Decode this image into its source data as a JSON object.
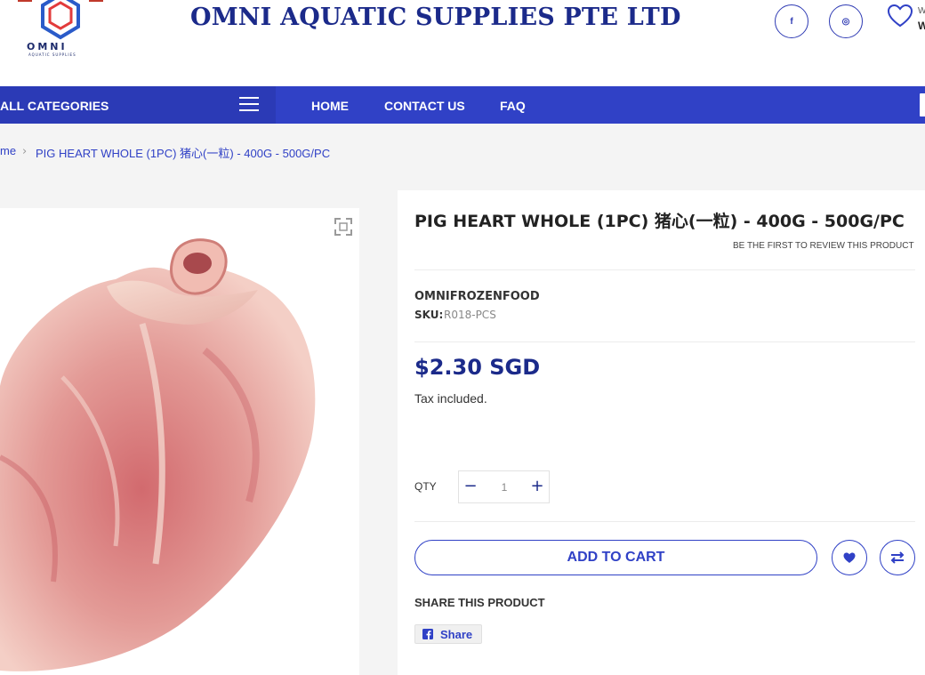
{
  "header": {
    "logo_text": "OMNI",
    "logo_sub": "AQUATIC SUPPLIES",
    "brand_name": "OMNI AQUATIC SUPPLIES PTE LTD",
    "social": [
      {
        "icon": "facebook-icon",
        "glyph": "f"
      },
      {
        "icon": "instagram-icon",
        "glyph": "◎"
      }
    ],
    "wishlist_small": "W",
    "wishlist_big": "W"
  },
  "nav": {
    "all_categories": "ALL CATEGORIES",
    "links": [
      "HOME",
      "CONTACT US",
      "FAQ"
    ]
  },
  "breadcrumb": {
    "home": "me",
    "separator": "›",
    "current": "PIG HEART WHOLE (1PC) 猪心(一粒) - 400G - 500G/PC"
  },
  "product": {
    "title": "PIG HEART WHOLE (1PC) 猪心(一粒) - 400G - 500G/PC",
    "review_link": "BE THE FIRST TO REVIEW THIS PRODUCT",
    "vendor": "OMNIFROZENFOOD",
    "sku_label": "SKU:",
    "sku_value": "R018-PCS",
    "price": "$2.30 SGD",
    "tax_note": "Tax included.",
    "qty_label": "QTY",
    "qty_value": "1",
    "add_to_cart": "ADD TO CART",
    "share_title": "SHARE THIS PRODUCT",
    "share_button": "Share"
  },
  "colors": {
    "brand_blue": "#3041c6",
    "dark_blue": "#1b2a8a"
  }
}
